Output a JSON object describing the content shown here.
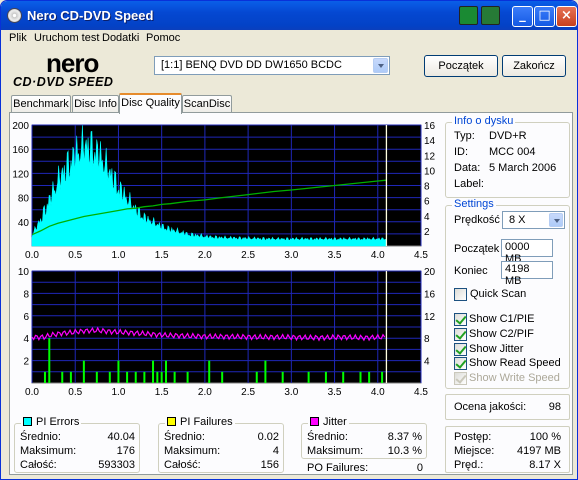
{
  "window": {
    "title": "Nero CD-DVD Speed"
  },
  "menu": [
    "Plik",
    "Uruchom test",
    "Dodatki",
    "Pomoc"
  ],
  "logo": {
    "top": "nero",
    "bottom": "CD·DVD SPEED"
  },
  "drive": {
    "selected": "[1:1]  BENQ DVD DD DW1650 BCDC"
  },
  "buttons": {
    "start": "Początek",
    "stop": "Zakończ"
  },
  "tabs": [
    "Benchmark",
    "Disc Info",
    "Disc Quality",
    "ScanDisc"
  ],
  "active_tab": "Disc Quality",
  "disc_info": {
    "title": "Info o dysku",
    "rows": [
      {
        "label": "Typ:",
        "value": "DVD+R"
      },
      {
        "label": "ID:",
        "value": "MCC 004"
      },
      {
        "label": "Data:",
        "value": "5 March 2006"
      },
      {
        "label": "Label:",
        "value": ""
      }
    ]
  },
  "settings": {
    "title": "Settings",
    "speed_label": "Prędkość",
    "speed_value": "8 X",
    "start_label": "Początek",
    "start_value": "0000 MB",
    "end_label": "Koniec",
    "end_value": "4198 MB",
    "quick_scan": {
      "label": "Quick Scan",
      "checked": false
    },
    "show": [
      {
        "label": "Show C1/PIE",
        "checked": true,
        "enabled": true
      },
      {
        "label": "Show C2/PIF",
        "checked": true,
        "enabled": true
      },
      {
        "label": "Show Jitter",
        "checked": true,
        "enabled": true
      },
      {
        "label": "Show Read Speed",
        "checked": true,
        "enabled": true
      },
      {
        "label": "Show Write Speed",
        "checked": true,
        "enabled": false
      }
    ]
  },
  "quality": {
    "label": "Ocena jakości:",
    "value": "98"
  },
  "progress": {
    "rows": [
      {
        "label": "Postęp:",
        "value": "100 %"
      },
      {
        "label": "Miejsce:",
        "value": "4197 MB"
      },
      {
        "label": "Pręd.:",
        "value": "8.17 X"
      }
    ]
  },
  "stats": {
    "pi_errors": {
      "title": "PI Errors",
      "color": "#00ffff",
      "rows": [
        {
          "label": "Średnio:",
          "value": "40.04"
        },
        {
          "label": "Maksimum:",
          "value": "176"
        },
        {
          "label": "Całość:",
          "value": "593303"
        }
      ]
    },
    "pi_failures": {
      "title": "PI Failures",
      "color": "#ffff00",
      "rows": [
        {
          "label": "Średnio:",
          "value": "0.02"
        },
        {
          "label": "Maksimum:",
          "value": "4"
        },
        {
          "label": "Całość:",
          "value": "156"
        }
      ]
    },
    "jitter": {
      "title": "Jitter",
      "color": "#ff00ff",
      "rows": [
        {
          "label": "Średnio:",
          "value": "8.37 %"
        },
        {
          "label": "Maksimum:",
          "value": "10.3 %"
        }
      ]
    },
    "po_failures": {
      "label": "PO Failures:",
      "value": "0"
    }
  },
  "chart_data": [
    {
      "type": "area",
      "x": [
        0.0,
        0.1,
        0.2,
        0.3,
        0.4,
        0.5,
        0.6,
        0.7,
        0.8,
        0.9,
        1.0,
        1.1,
        1.2,
        1.3,
        1.4,
        1.5,
        1.6,
        1.8,
        2.0,
        2.2,
        2.5,
        2.8,
        3.0,
        3.5,
        4.0,
        4.1
      ],
      "series": [
        {
          "values": [
            18,
            45,
            78,
            110,
            135,
            155,
            170,
            168,
            150,
            125,
            100,
            80,
            62,
            48,
            40,
            33,
            28,
            20,
            16,
            14,
            13,
            12,
            12,
            12,
            12,
            12
          ],
          "color": "#00ffff"
        },
        {
          "values": [
            1.5,
            2.0,
            2.6,
            3.0,
            3.3,
            3.6,
            3.9,
            4.1,
            4.3,
            4.5,
            4.7,
            4.9,
            5.0,
            5.2,
            5.3,
            5.5,
            5.6,
            5.9,
            6.1,
            6.4,
            6.8,
            7.2,
            7.4,
            8.0,
            8.6,
            8.7
          ],
          "color": "#00b000",
          "axis": "right"
        }
      ],
      "xlim": [
        0,
        4.5
      ],
      "ylim": [
        0,
        200
      ],
      "y2lim": [
        0,
        16
      ],
      "xticks": [
        "0.0",
        "0.5",
        "1.0",
        "1.5",
        "2.0",
        "2.5",
        "3.0",
        "3.5",
        "4.0",
        "4.5"
      ],
      "yticks": [
        "40",
        "80",
        "120",
        "160",
        "200"
      ],
      "y2ticks": [
        "2",
        "4",
        "6",
        "8",
        "10",
        "12",
        "14",
        "16"
      ],
      "marker_x": 4.1,
      "grid": true
    },
    {
      "type": "bar",
      "x": [
        0.15,
        0.2,
        0.35,
        0.45,
        0.6,
        0.75,
        0.9,
        1.0,
        1.1,
        1.2,
        1.3,
        1.4,
        1.45,
        1.5,
        1.55,
        1.65,
        1.8,
        2.05,
        2.2,
        2.6,
        2.7,
        2.9,
        3.2,
        3.4,
        3.6,
        3.8,
        3.9,
        4.05
      ],
      "series": [
        {
          "name": "PI Failures",
          "values": [
            1,
            4,
            1,
            1,
            2,
            1,
            1,
            2,
            1,
            1,
            1,
            2,
            1,
            1,
            2,
            1,
            1,
            2,
            1,
            1,
            2,
            1,
            1,
            1,
            1,
            1,
            1,
            1
          ],
          "color": "#00ff00"
        },
        {
          "name": "Jitter",
          "values": [
            8.2,
            8.5,
            8.9,
            9.0,
            9.3,
            9.4,
            9.2,
            9.1,
            9.0,
            8.9,
            8.8,
            8.7,
            8.6,
            8.6,
            8.5,
            8.5,
            8.4,
            8.3,
            8.3,
            8.2,
            8.2,
            8.2,
            8.1,
            8.1,
            8.2,
            8.1,
            8.1,
            8.2
          ],
          "color": "#ff00ff",
          "axis": "right"
        }
      ],
      "xlim": [
        0,
        4.5
      ],
      "ylim": [
        0,
        10
      ],
      "y2lim": [
        0,
        20
      ],
      "xticks": [
        "0.0",
        "0.5",
        "1.0",
        "1.5",
        "2.0",
        "2.5",
        "3.0",
        "3.5",
        "4.0",
        "4.5"
      ],
      "yticks": [
        "2",
        "4",
        "6",
        "8",
        "10"
      ],
      "y2ticks": [
        "4",
        "8",
        "12",
        "16",
        "20"
      ],
      "marker_x": 4.1,
      "grid": true
    }
  ]
}
